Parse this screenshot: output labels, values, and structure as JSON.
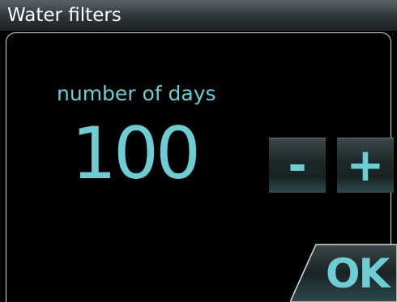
{
  "window": {
    "title": "Water filters"
  },
  "setting": {
    "label": "number of days",
    "value": "100"
  },
  "controls": {
    "decrement_label": "-",
    "increment_label": "+",
    "ok_label": "OK"
  },
  "colors": {
    "accent": "#6ccdd2",
    "background": "#000000",
    "title_text": "#ffffff",
    "frame_border": "#d9dcdc"
  },
  "icons": {
    "decrement": "minus-icon",
    "increment": "plus-icon"
  }
}
